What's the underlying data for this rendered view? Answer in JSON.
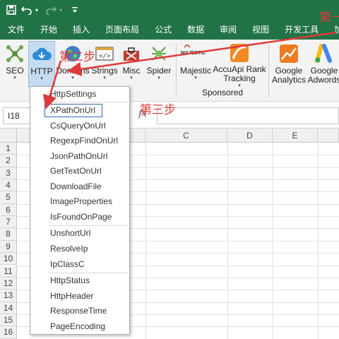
{
  "quick_access": {
    "save_icon": "save-icon",
    "undo_icon": "undo-icon",
    "redo_icon": "redo-icon",
    "customize_icon": "customize-icon"
  },
  "tabs": [
    "文件",
    "开始",
    "插入",
    "页面布局",
    "公式",
    "数据",
    "审阅",
    "视图",
    "开发工具",
    "加"
  ],
  "ribbon": {
    "buttons": [
      {
        "label": "SEO",
        "icon": "seo-icon",
        "has_dropdown": true
      },
      {
        "label": "HTTP",
        "icon": "http-cloud-icon",
        "has_dropdown": true,
        "active": true
      },
      {
        "label": "Domains",
        "icon": "globe-icon",
        "has_dropdown": true
      },
      {
        "label": "Strings",
        "icon": "code-icon",
        "has_dropdown": true
      },
      {
        "label": "Misc",
        "icon": "toolbox-icon",
        "has_dropdown": true
      },
      {
        "label": "Spider",
        "icon": "spider-icon",
        "has_dropdown": true
      },
      {
        "label": "Majestic",
        "icon": "majestic-icon",
        "has_dropdown": true
      },
      {
        "label": "AccuApi Rank Tracking",
        "label_line1": "AccuApi Rank",
        "label_line2": "Tracking",
        "icon": "accuapi-icon",
        "has_dropdown": true
      },
      {
        "label": "Google Analytics",
        "label_line1": "Google",
        "label_line2": "Analytics",
        "icon": "google-analytics-icon"
      },
      {
        "label": "Google Adwords",
        "label_line1": "Google",
        "label_line2": "Adwords",
        "icon": "google-adwords-icon"
      }
    ],
    "majestic_logo_text": "MAJESTIC",
    "group_label": "Sponsored"
  },
  "formula_bar": {
    "name_box": "I18",
    "fx": "fx",
    "value": ""
  },
  "grid": {
    "columns": [
      "C",
      "D",
      "E"
    ],
    "rows": [
      "1",
      "2",
      "3",
      "4",
      "5",
      "6",
      "7",
      "8",
      "9",
      "10",
      "11",
      "12",
      "13",
      "14",
      "15",
      "16"
    ]
  },
  "menu": {
    "items": [
      "HttpSettings",
      "XPathOnUrl",
      "CsQueryOnUrl",
      "RegexpFindOnUrl",
      "JsonPathOnUrl",
      "GetTextOnUrl",
      "DownloadFile",
      "ImageProperties",
      "IsFoundOnPage",
      "UnshortUrl",
      "ResolveIp",
      "IpClassC",
      "HttpStatus",
      "HttpHeader",
      "ResponseTime",
      "PageEncoding"
    ],
    "highlighted": "XPathOnUrl"
  },
  "annotations": {
    "step1": "第一",
    "step2": "第二步",
    "step3": "第三步",
    "color": "#e03a3a"
  },
  "colors": {
    "excel_green": "#217346",
    "active_button": "#c5dcf0",
    "highlight_border": "#2b6ab4"
  }
}
